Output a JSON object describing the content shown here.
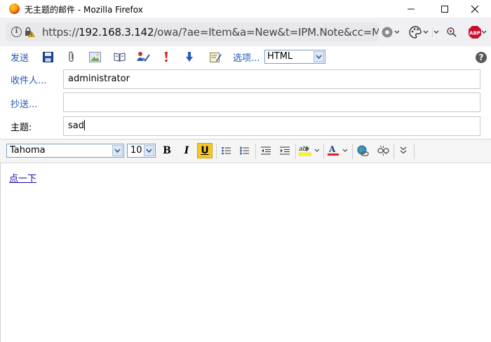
{
  "window": {
    "title": "无主题的邮件 - Mozilla Firefox",
    "minimize_icon": "minimize-icon",
    "maximize_icon": "maximize-icon",
    "close_icon": "close-icon"
  },
  "address_bar": {
    "url_scheme": "https://",
    "url_host": "192.168.3.142",
    "url_rest": "/owa/?ae=Item&a=New&t=IPM.Note&cc=MTO",
    "icons": [
      "info-icon",
      "insecure-lock-icon",
      "extension-icon",
      "palette-icon",
      "menu-icon",
      "search-addon-icon",
      "adblock-plus-icon"
    ],
    "abp_label": "ABP"
  },
  "toolbar": {
    "send_label": "发送",
    "options_label": "选项...",
    "format_value": "HTML",
    "help_label": "?",
    "icons": [
      "save-icon",
      "attach-icon",
      "insert-image-icon",
      "address-book-icon",
      "check-names-icon",
      "high-importance-icon",
      "low-importance-icon",
      "signature-icon"
    ]
  },
  "header": {
    "to_label": "收件人...",
    "to_value": "administrator",
    "cc_label": "抄送...",
    "cc_value": "",
    "subject_label": "主题:",
    "subject_value": "sad"
  },
  "formatting": {
    "font_value": "Tahoma",
    "size_value": "10",
    "bold_label": "B",
    "italic_label": "I",
    "underline_label": "U",
    "highlight_label": "ab",
    "font_color_label": "A",
    "icons": [
      "bullets-icon",
      "numbering-icon",
      "decrease-indent-icon",
      "increase-indent-icon",
      "highlight-icon",
      "font-color-icon",
      "insert-link-icon",
      "remove-link-icon",
      "more-options-icon"
    ],
    "highlight_color": "#ffff00",
    "font_color": "#e02020",
    "active_button": "underline"
  },
  "body": {
    "link_text": "点一下"
  }
}
